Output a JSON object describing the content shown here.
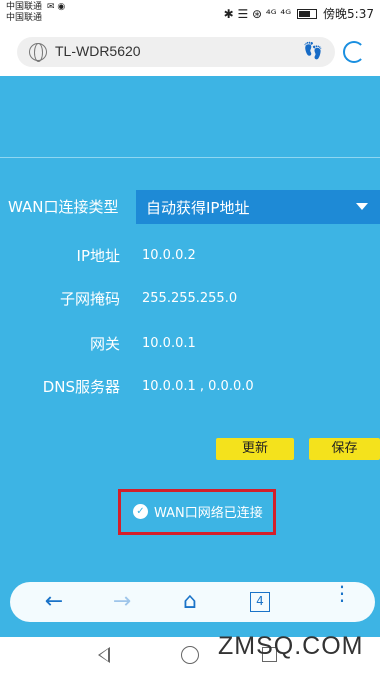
{
  "status_bar": {
    "carrier1": "中国联通",
    "carrier2": "中国联通",
    "time": "傍晚5:37",
    "indicators": "✱ ☰ ⊛ ⁴ᴳ ⁴ᴳ"
  },
  "browser": {
    "url": "TL-WDR5620",
    "footprint_icon": "footprint-icon",
    "reload_icon": "reload-icon"
  },
  "form": {
    "wan_type_label": "WAN口连接类型",
    "wan_type_value": "自动获得IP地址",
    "ip_label": "IP地址",
    "ip_value": "10.0.0.2",
    "mask_label": "子网掩码",
    "mask_value": "255.255.255.0",
    "gateway_label": "网关",
    "gateway_value": "10.0.0.1",
    "dns_label": "DNS服务器",
    "dns_value": "10.0.0.1 , 0.0.0.0",
    "refresh_label": "更新",
    "save_label": "保存",
    "status_text": "WAN口网络已连接"
  },
  "nav": {
    "tab_count": "4"
  },
  "watermark": "ZMSQ.COM",
  "colors": {
    "page_bg": "#3db4e4",
    "select_bg": "#1e8ad6",
    "button_bg": "#f4e21c",
    "highlight_border": "#d41f2a"
  }
}
